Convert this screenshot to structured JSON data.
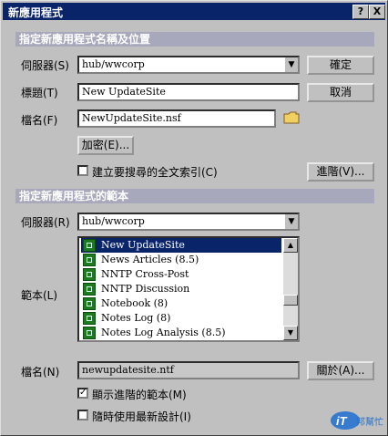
{
  "window": {
    "title": "新應用程式",
    "help_btn": "?",
    "close_btn": "X"
  },
  "section1": {
    "header": "指定新應用程式名稱及位置"
  },
  "server1": {
    "label": "伺服器(S)",
    "value": "hub/wwcorp"
  },
  "title_field": {
    "label": "標題(T)",
    "value": "New UpdateSite"
  },
  "filename1": {
    "label": "檔名(F)",
    "value": "NewUpdateSite.nsf"
  },
  "buttons": {
    "ok": "確定",
    "cancel": "取消",
    "encrypt": "加密(E)...",
    "advanced": "進階(V)...",
    "about": "關於(A)..."
  },
  "fulltext": {
    "label": "建立要搜尋的全文索引(C)",
    "checked": false
  },
  "section2": {
    "header": "指定新應用程式的範本"
  },
  "server2": {
    "label": "伺服器(R)",
    "value": "hub/wwcorp"
  },
  "template": {
    "label": "範本(L)",
    "items": [
      "New UpdateSite",
      "News Articles (8.5)",
      "NNTP Cross-Post",
      "NNTP Discussion",
      "Notebook (8)",
      "Notes Log (8)",
      "Notes Log Analysis (8.5)"
    ],
    "selected": 0
  },
  "filename2": {
    "label": "檔名(N)",
    "value": "newupdatesite.ntf"
  },
  "show_advanced": {
    "label": "顯示進階的範本(M)",
    "checked": true
  },
  "inherit": {
    "label": "隨時使用最新設計(I)",
    "checked": false
  },
  "logo": {
    "text": "iT邦幫忙"
  },
  "colors": {
    "titlebar": "#0a246a",
    "section": "#a8a8bc",
    "selection": "#0a246a",
    "icon": "#1e7a1e"
  }
}
